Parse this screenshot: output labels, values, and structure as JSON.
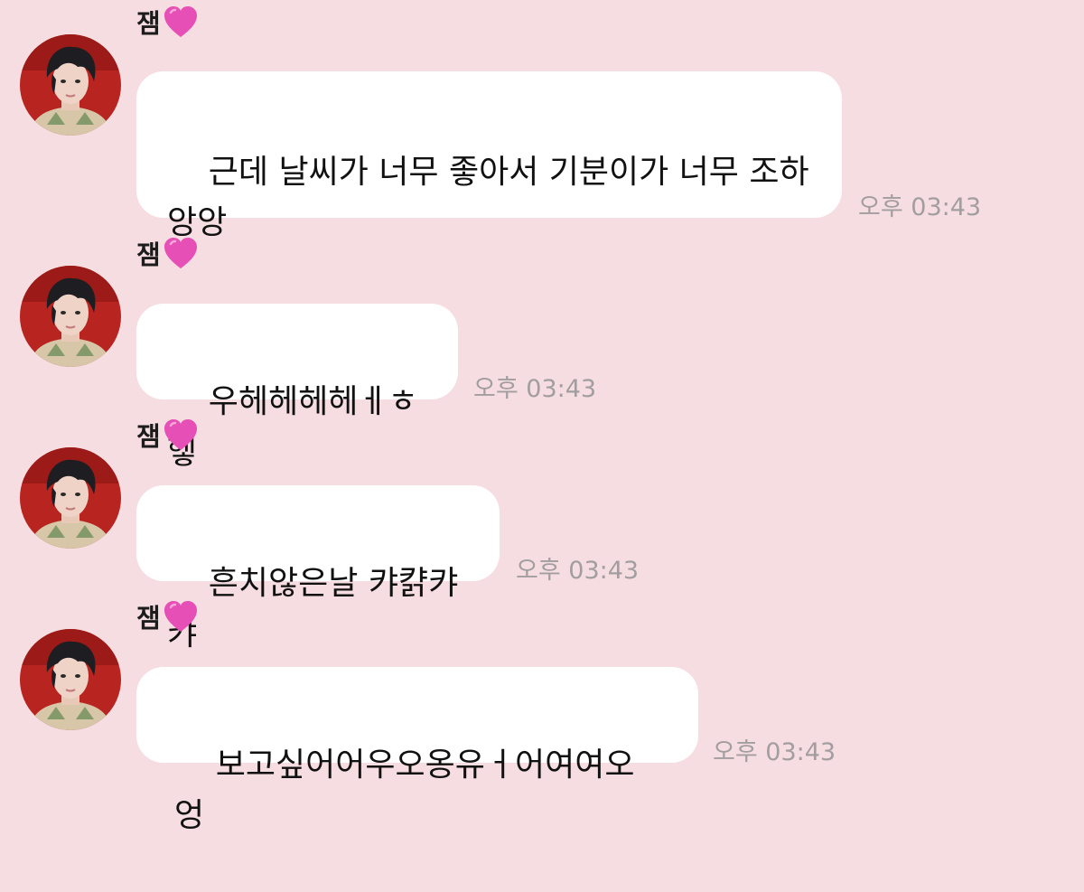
{
  "chat": {
    "colors": {
      "background": "#f6dde2",
      "bubble": "#ffffff",
      "timestamp": "#a29ea0",
      "heart": "#e64fb5"
    },
    "messages": [
      {
        "sender": "잼",
        "sender_icon": "pink-heart-icon",
        "text": "근데 날씨가 너무 좋아서 기분이가 너무 조하\n앙앙",
        "time": "오후 03:43"
      },
      {
        "sender": "잼",
        "sender_icon": "pink-heart-icon",
        "text": "우헤헤헤헤ㅔㅎ헿",
        "time": "오후 03:43"
      },
      {
        "sender": "잼",
        "sender_icon": "pink-heart-icon",
        "text": "흔치않은날 캬캵캬캬",
        "time": "오후 03:43"
      },
      {
        "sender": "잼",
        "sender_icon": "pink-heart-icon",
        "text": "보고싶어어우오옹유ㅓ어여여오엉",
        "time": "오후 03:43"
      }
    ]
  }
}
